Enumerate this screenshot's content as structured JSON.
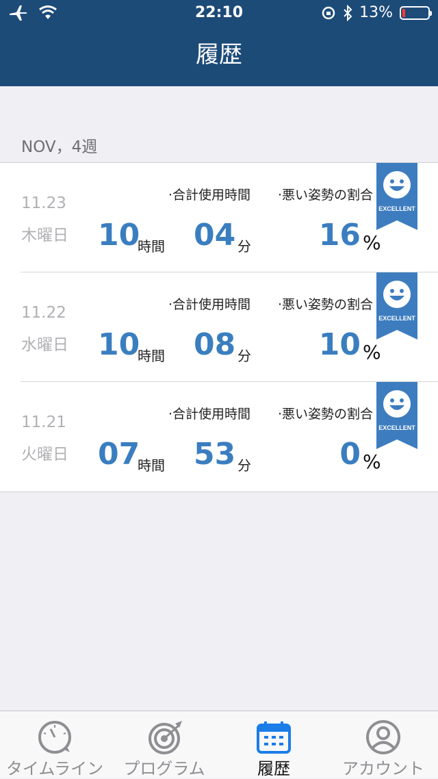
{
  "status_bar": {
    "time": "22:10",
    "battery": "13%",
    "icons": [
      "airplane-icon",
      "wifi-icon",
      "rotation-lock-icon",
      "bluetooth-icon",
      "battery-icon"
    ]
  },
  "nav": {
    "title": "履歴"
  },
  "section": {
    "week_label": "NOV，4週"
  },
  "entries": [
    {
      "date": "11.23",
      "weekday": "木曜日",
      "total_label": "·合計使用時間",
      "bad_label": "·悪い姿勢の割合",
      "hours": "10",
      "hours_unit": "時間",
      "minutes": "04",
      "minutes_unit": "分",
      "percent": "16",
      "percent_unit": "%",
      "badge": "EXCELLENT"
    },
    {
      "date": "11.22",
      "weekday": "水曜日",
      "total_label": "·合計使用時間",
      "bad_label": "·悪い姿勢の割合",
      "hours": "10",
      "hours_unit": "時間",
      "minutes": "08",
      "minutes_unit": "分",
      "percent": "10",
      "percent_unit": "%",
      "badge": "EXCELLENT"
    },
    {
      "date": "11.21",
      "weekday": "火曜日",
      "total_label": "·合計使用時間",
      "bad_label": "·悪い姿勢の割合",
      "hours": "07",
      "hours_unit": "時間",
      "minutes": "53",
      "minutes_unit": "分",
      "percent": "0",
      "percent_unit": "%",
      "badge": "EXCELLENT"
    }
  ],
  "tabs": [
    {
      "label": "タイムライン",
      "icon": "gauge-icon"
    },
    {
      "label": "プログラム",
      "icon": "target-icon"
    },
    {
      "label": "履歴",
      "icon": "calendar-icon"
    },
    {
      "label": "アカウント",
      "icon": "account-icon"
    }
  ],
  "colors": {
    "header": "#1d4b78",
    "accent": "#3a7ec0",
    "ribbon": "#3d7dbf",
    "tab_active": "#1a7de8",
    "tab_inactive": "#8e8e93"
  }
}
